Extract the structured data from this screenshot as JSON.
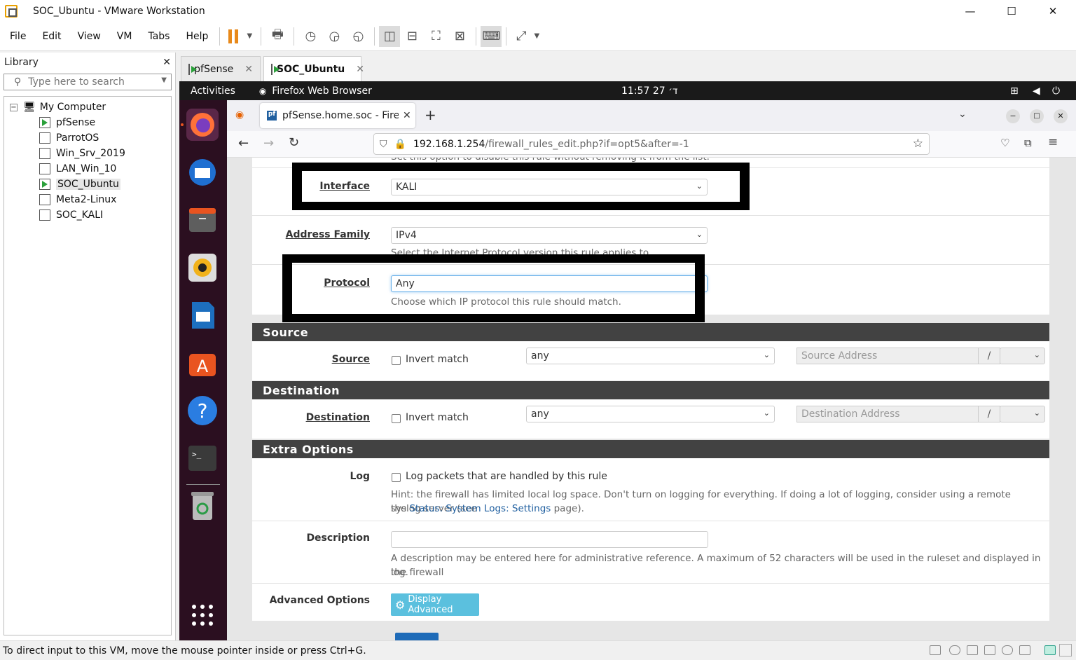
{
  "window": {
    "title": "SOC_Ubuntu - VMware Workstation",
    "minimize": "—",
    "maximize": "☐",
    "close": "✕"
  },
  "menu": [
    "File",
    "Edit",
    "View",
    "VM",
    "Tabs",
    "Help"
  ],
  "library": {
    "title": "Library",
    "close": "✕",
    "search_placeholder": "Type here to search",
    "root": "My Computer",
    "vms": [
      {
        "name": "pfSense",
        "running": true
      },
      {
        "name": "ParrotOS",
        "running": false
      },
      {
        "name": "Win_Srv_2019",
        "running": false
      },
      {
        "name": "LAN_Win_10",
        "running": false
      },
      {
        "name": "SOC_Ubuntu",
        "running": true
      },
      {
        "name": "Meta2-Linux",
        "running": false
      },
      {
        "name": "SOC_KALI",
        "running": false
      }
    ]
  },
  "vm_tabs": [
    {
      "label": "pfSense",
      "active": false
    },
    {
      "label": "SOC_Ubuntu",
      "active": true
    }
  ],
  "gnome": {
    "activities": "Activities",
    "app": "Firefox Web Browser",
    "clock": "ד׳ 27  11:57"
  },
  "firefox": {
    "tab_title": "pfSense.home.soc - Firew",
    "url_host": "192.168.1.254",
    "url_path": "/firewall_rules_edit.php?if=opt5&after=-1"
  },
  "form": {
    "disabled_help": "Set this option to disable this rule without removing it from the list.",
    "interface_label": "Interface",
    "interface_value": "KALI",
    "address_family_label": "Address Family",
    "address_family_value": "IPv4",
    "address_family_help": "Select the Internet Protocol version this rule applies to.",
    "protocol_label": "Protocol",
    "protocol_value": "Any",
    "protocol_help": "Choose which IP protocol this rule should match.",
    "source_section": "Source",
    "source_label": "Source",
    "source_invert": "Invert match",
    "source_value": "any",
    "source_address_placeholder": "Source Address",
    "slash": "/",
    "destination_section": "Destination",
    "destination_label": "Destination",
    "destination_invert": "Invert match",
    "destination_value": "any",
    "destination_address_placeholder": "Destination Address",
    "extra_section": "Extra Options",
    "log_label": "Log",
    "log_checkbox": "Log packets that are handled by this rule",
    "log_hint_1": "Hint: the firewall has limited local log space. Don't turn on logging for everything. If doing a lot of logging, consider using a remote syslog server (see",
    "log_hint_the": "the",
    "log_hint_link": "Status: System Logs: Settings",
    "log_hint_end": "page).",
    "description_label": "Description",
    "description_help_1": "A description may be entered here for administrative reference. A maximum of 52 characters will be used in the ruleset and displayed in the firewall",
    "description_help_2": "log.",
    "advanced_label": "Advanced Options",
    "advanced_button": "Display Advanced"
  },
  "status_bar": "To direct input to this VM, move the mouse pointer inside or press Ctrl+G."
}
